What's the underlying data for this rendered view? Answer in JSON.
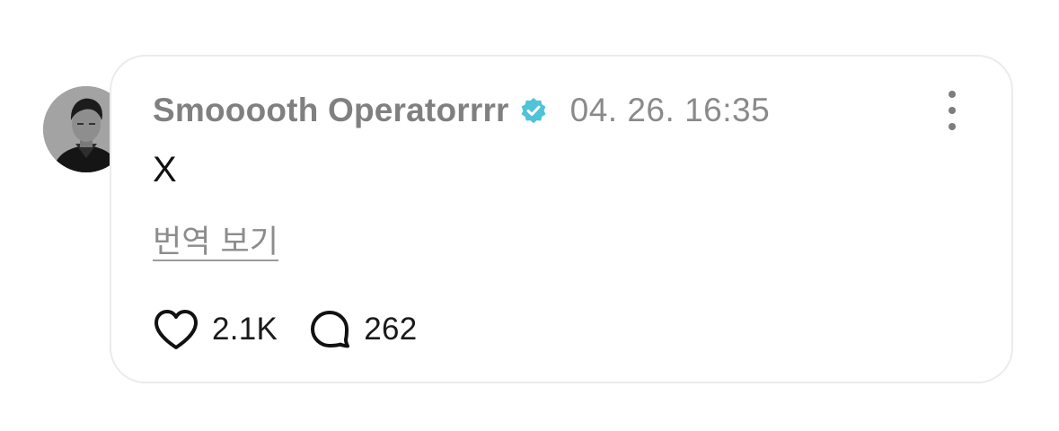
{
  "post": {
    "author_name": "Smooooth Operatorrrr",
    "timestamp": "04. 26. 16:35",
    "text": "X",
    "translate_label": "번역 보기",
    "likes_count": "2.1K",
    "comments_count": "262"
  },
  "icons": {
    "verified": "verified-badge-icon",
    "more": "more-vertical-icon",
    "like": "heart-icon",
    "comment": "speech-bubble-icon"
  },
  "colors": {
    "verified_badge": "#4fc3d7",
    "author": "#808080",
    "timestamp": "#8a8a8a",
    "text": "#111111",
    "card_border": "#ebebeb"
  }
}
